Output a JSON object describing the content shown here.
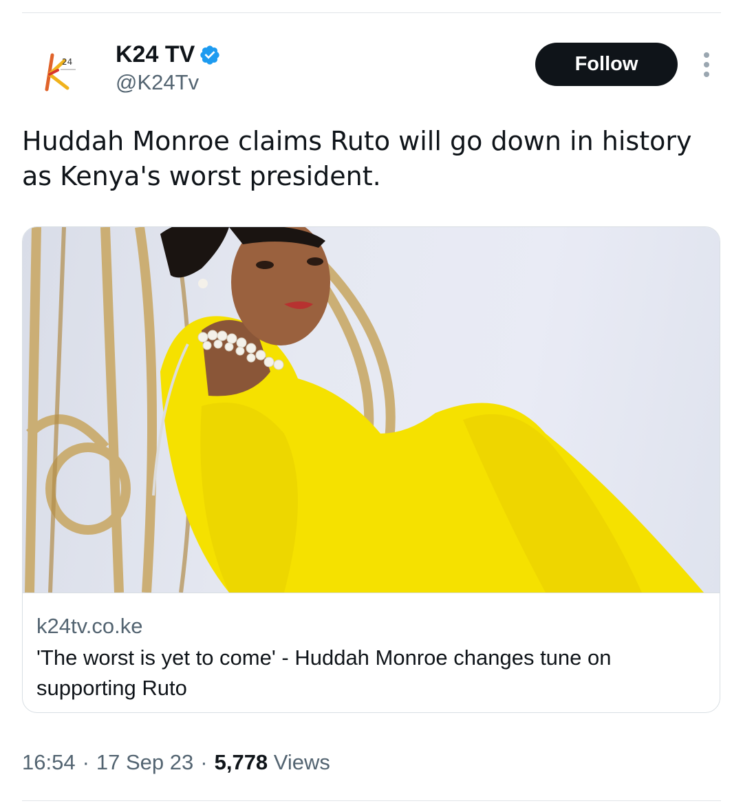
{
  "account": {
    "display_name": "K24 TV",
    "handle": "@K24Tv",
    "verified": true,
    "verified_color": "#1d9bf0",
    "avatar_icon": "k24-logo-icon"
  },
  "follow_button": {
    "label": "Follow"
  },
  "more_icon": "more-options-icon",
  "tweet": {
    "text": "Huddah Monroe claims Ruto will go down in history as Kenya's worst president."
  },
  "link_card": {
    "domain": "k24tv.co.ke",
    "title": "'The worst is yet to come' - Huddah Monroe changes tune on supporting Ruto"
  },
  "meta": {
    "time": "16:54",
    "separator": "·",
    "date": "17 Sep 23",
    "views_count": "5,778",
    "views_label": "Views"
  },
  "colors": {
    "text_primary": "#0f1419",
    "text_secondary": "#536471",
    "follow_bg": "#0f1419",
    "dress_yellow": "#f5e100"
  }
}
